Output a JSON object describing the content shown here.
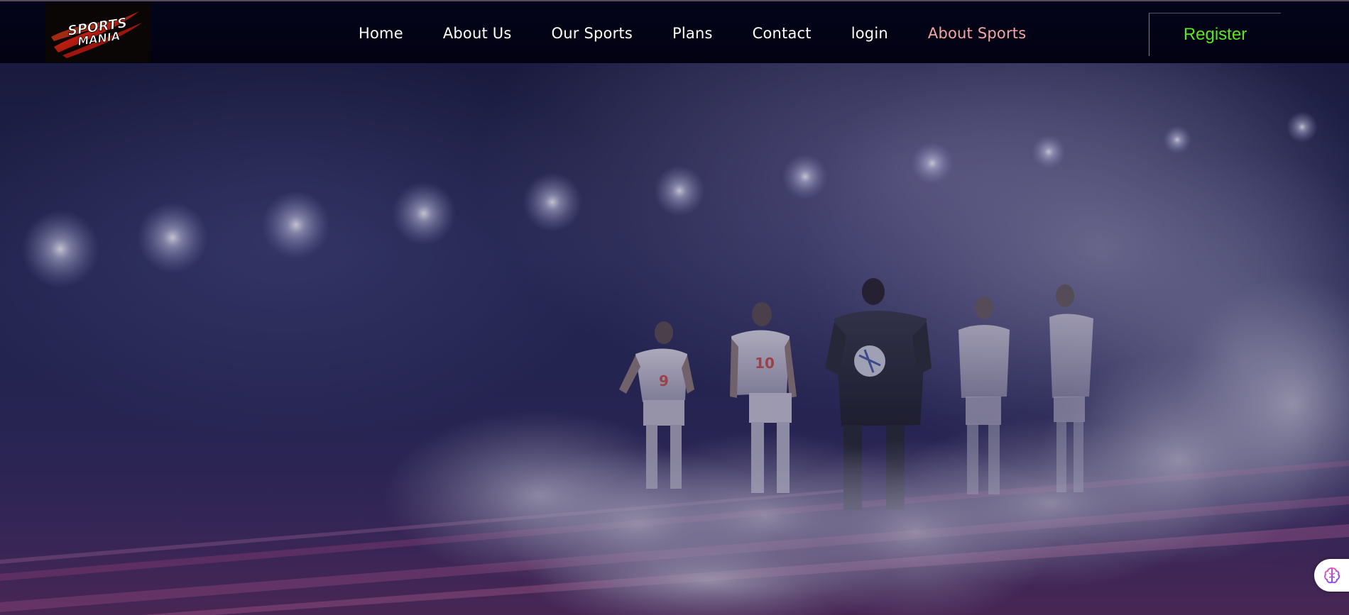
{
  "brand": {
    "logo_line1": "SPORTS",
    "logo_line2": "MANIA"
  },
  "nav": {
    "items": [
      {
        "label": "Home",
        "active": false
      },
      {
        "label": "About Us",
        "active": false
      },
      {
        "label": "Our Sports",
        "active": false
      },
      {
        "label": "Plans",
        "active": false
      },
      {
        "label": "Contact",
        "active": false
      },
      {
        "label": "login",
        "active": false
      },
      {
        "label": "About Sports",
        "active": true
      }
    ],
    "register_label": "Register"
  },
  "hero": {
    "player_numbers": [
      "9",
      "10"
    ]
  },
  "colors": {
    "nav_background": "#02020f",
    "nav_text": "#ffffff",
    "active_link": "#f4a5a5",
    "register_text": "#58e81b",
    "hero_background": "#272954"
  },
  "icons": {
    "assistant": "brain-icon"
  }
}
